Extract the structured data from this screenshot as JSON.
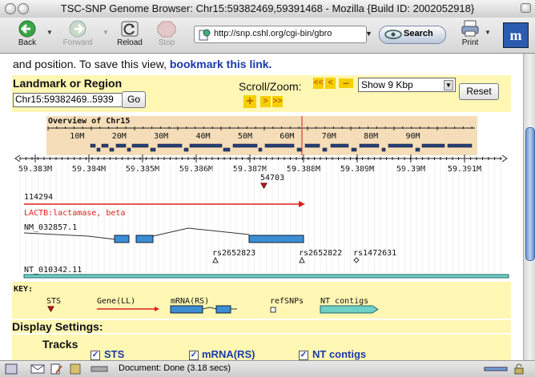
{
  "window": {
    "title": "TSC-SNP Genome Browser: Chr15:59382469,59391468 - Mozilla {Build ID: 2002052918}"
  },
  "toolbar": {
    "back": "Back",
    "forward": "Forward",
    "reload": "Reload",
    "stop": "Stop",
    "url": "http://snp.cshl.org/cgi-bin/gbro",
    "search": "Search",
    "print": "Print"
  },
  "page": {
    "intro_text": "and position. To save this view,",
    "intro_link": "bookmark this link."
  },
  "nav": {
    "landmark_label": "Landmark or Region",
    "region_value": "Chr15:59382469..5939",
    "go": "Go",
    "scroll_label": "Scroll/Zoom:",
    "zoom_value": "Show 9 Kbp",
    "reset": "Reset"
  },
  "overview": {
    "title": "Overview of Chr15",
    "ticks": [
      "10M",
      "20M",
      "30M",
      "40M",
      "50M",
      "60M",
      "70M",
      "80M",
      "90M"
    ]
  },
  "detail": {
    "ticks": [
      "59.383M",
      "59.384M",
      "59.385M",
      "59.386M",
      "59.387M",
      "59.388M",
      "59.389M",
      "59.39M",
      "59.391M"
    ]
  },
  "tracks": {
    "sts_label": "54703",
    "gene_id": "114294",
    "gene_name": "LACTB:lactamase, beta",
    "mrna_label": "NM_032857.1",
    "snps": [
      "rs2652823",
      "rs2652822",
      "rs1472631"
    ],
    "contig_label": "NT_010342.11"
  },
  "key": {
    "title": "KEY:",
    "items": [
      "STS",
      "Gene(LL)",
      "mRNA(RS)",
      "refSNPs",
      "NT contigs"
    ]
  },
  "display": {
    "title": "Display Settings:",
    "tracks_label": "Tracks",
    "checkboxes": [
      "STS",
      "mRNA(RS)",
      "NT contigs"
    ]
  },
  "status": {
    "text": "Document: Done (3.18 secs)"
  },
  "colors": {
    "panel": "#fff7b3",
    "link": "#1a3aa8",
    "gene": "#e02020",
    "mrna": "#3b8ed4",
    "contig": "#6fd0c8",
    "overview_band": "#f4ddb8"
  }
}
